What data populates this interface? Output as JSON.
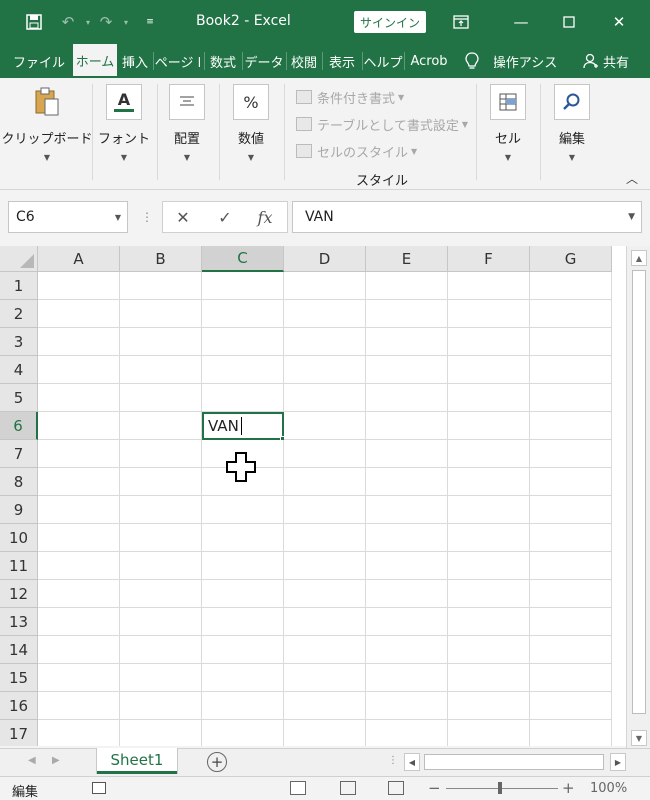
{
  "app": {
    "window_title": "Book2  -  Excel",
    "signin_label": "サインイン"
  },
  "ribbon_tabs": [
    {
      "label": "ファイル",
      "active": false
    },
    {
      "label": "ホーム",
      "active": true
    },
    {
      "label": "挿入",
      "active": false
    },
    {
      "label": "ページ l",
      "active": false
    },
    {
      "label": "数式",
      "active": false
    },
    {
      "label": "データ",
      "active": false
    },
    {
      "label": "校閲",
      "active": false
    },
    {
      "label": "表示",
      "active": false
    },
    {
      "label": "ヘルプ",
      "active": false
    },
    {
      "label": "Acrob",
      "active": false
    }
  ],
  "tell_me": "操作アシス",
  "share_label": "共有",
  "ribbon": {
    "clipboard": "クリップボード",
    "font": "フォント",
    "alignment": "配置",
    "number": "数値",
    "number_icon": "%",
    "font_icon": "A",
    "conditional_format": "条件付き書式",
    "format_as_table": "テーブルとして書式設定",
    "cell_styles": "セルのスタイル",
    "styles_group": "スタイル",
    "cells": "セル",
    "editing": "編集"
  },
  "formula_bar": {
    "name_box": "C6",
    "fx_label": "fx",
    "content": "VAN"
  },
  "columns": [
    "A",
    "B",
    "C",
    "D",
    "E",
    "F",
    "G"
  ],
  "selected_column": "C",
  "rows": [
    "1",
    "2",
    "3",
    "4",
    "5",
    "6",
    "7",
    "8",
    "9",
    "10",
    "11",
    "12",
    "13",
    "14",
    "15",
    "16",
    "17"
  ],
  "selected_row": "6",
  "active_cell": {
    "ref": "C6",
    "value": "VAN"
  },
  "sheet_tab": "Sheet1",
  "status": {
    "mode": "編集",
    "zoom": "100%"
  },
  "colors": {
    "accent": "#217346"
  }
}
